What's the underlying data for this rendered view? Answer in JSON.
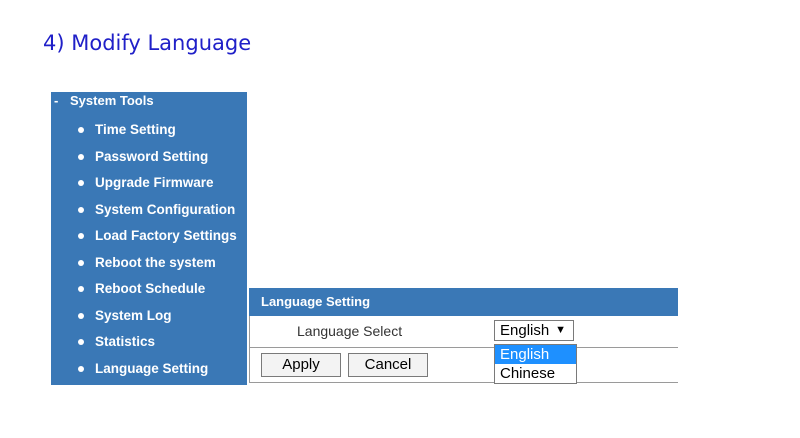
{
  "heading": "4) Modify Language",
  "sidebar": {
    "section_toggle": "-",
    "section_title": "System Tools",
    "items": [
      {
        "label": "Time Setting"
      },
      {
        "label": "Password Setting"
      },
      {
        "label": "Upgrade Firmware"
      },
      {
        "label": "System Configuration"
      },
      {
        "label": "Load Factory Settings"
      },
      {
        "label": "Reboot the system"
      },
      {
        "label": "Reboot Schedule"
      },
      {
        "label": "System Log"
      },
      {
        "label": "Statistics"
      },
      {
        "label": "Language Setting"
      }
    ]
  },
  "panel": {
    "title": "Language Setting",
    "field_label": "Language Select",
    "select": {
      "value": "English",
      "arrow": "▼",
      "options": [
        "English",
        "Chinese"
      ],
      "highlighted": "English"
    },
    "apply_label": "Apply",
    "cancel_label": "Cancel"
  },
  "colors": {
    "heading": "#2020c8",
    "sidebar_bg": "#3a78b6",
    "header_bg": "#3a78b6",
    "option_highlight": "#1e90ff"
  },
  "icons": {
    "bullet": "bullet-icon",
    "collapse": "minus-icon",
    "dropdown": "chevron-down-icon"
  }
}
